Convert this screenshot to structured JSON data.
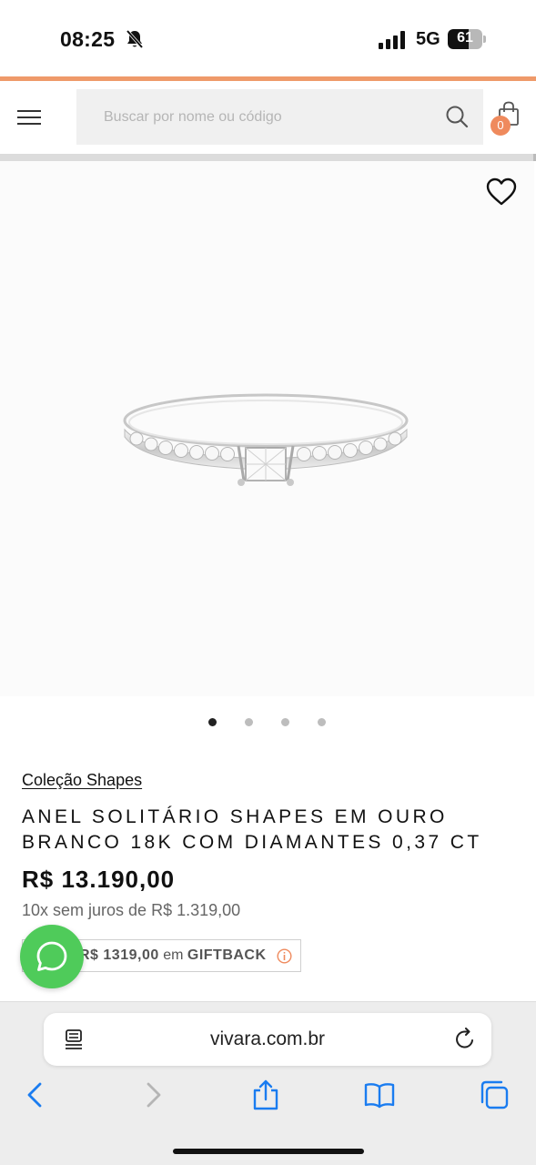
{
  "status_bar": {
    "time": "08:25",
    "network": "5G",
    "battery_level": "61",
    "battery_fraction": 0.61
  },
  "header": {
    "search_placeholder": "Buscar por nome ou código",
    "cart_count": "0"
  },
  "carousel": {
    "total_images": 4,
    "active_index": 0
  },
  "product": {
    "collection": "Coleção Shapes",
    "title": "ANEL SOLITÁRIO SHAPES EM OURO BRANCO 18K COM DIAMANTES 0,37 CT",
    "price": "R$ 13.190,00",
    "installments": "10x sem juros de R$ 1.319,00",
    "giftback_amount": "R$ 1319,00",
    "giftback_connector": "em",
    "giftback_label": "GIFTBACK"
  },
  "browser": {
    "url": "vivara.com.br"
  },
  "colors": {
    "accent_orange": "#ef9a6a",
    "badge": "#ef8a5d",
    "whatsapp": "#4fcb5a",
    "safari_blue": "#1a7cf0"
  }
}
